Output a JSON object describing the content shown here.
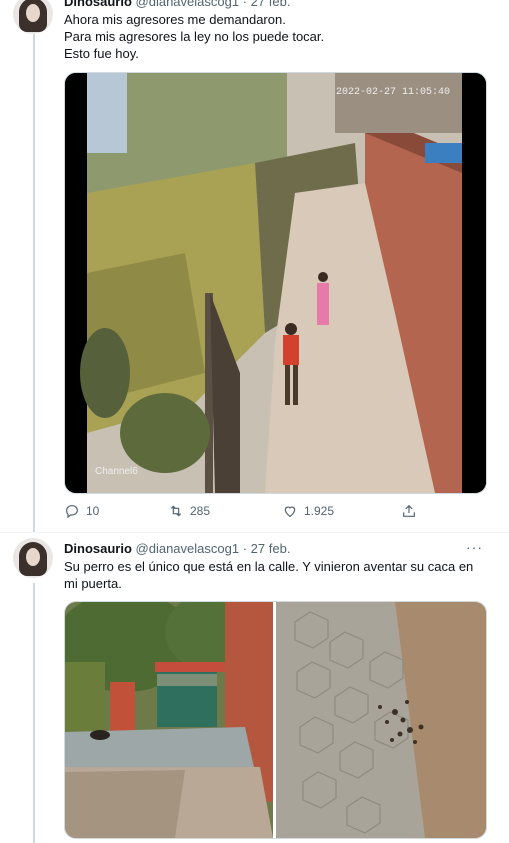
{
  "tweet1": {
    "display_name": "Dinosaurio",
    "handle": "@dianavelascog1",
    "separator": "·",
    "date": "27 feb.",
    "lines": [
      "Ahora mis agresores me demandaron.",
      "Para mis agresores la ley no los puede tocar.",
      "Esto fue hoy."
    ],
    "video_timestamp": "2022-02-27 11:05:40",
    "video_watermark": "Channel6",
    "replies": "10",
    "retweets": "285",
    "likes": "1.925"
  },
  "tweet2": {
    "display_name": "Dinosaurio",
    "handle": "@dianavelascog1",
    "separator": "·",
    "date": "27 feb.",
    "text": "Su perro es el único que está en la calle. Y vinieron aventar su caca en mi puerta.",
    "more": "···"
  },
  "icons": {
    "reply": "reply-icon",
    "retweet": "retweet-icon",
    "like": "heart-icon",
    "share": "share-icon",
    "more": "more-icon"
  },
  "colors": {
    "secondary_text": "#536471",
    "thread_line": "#cfd9de"
  }
}
